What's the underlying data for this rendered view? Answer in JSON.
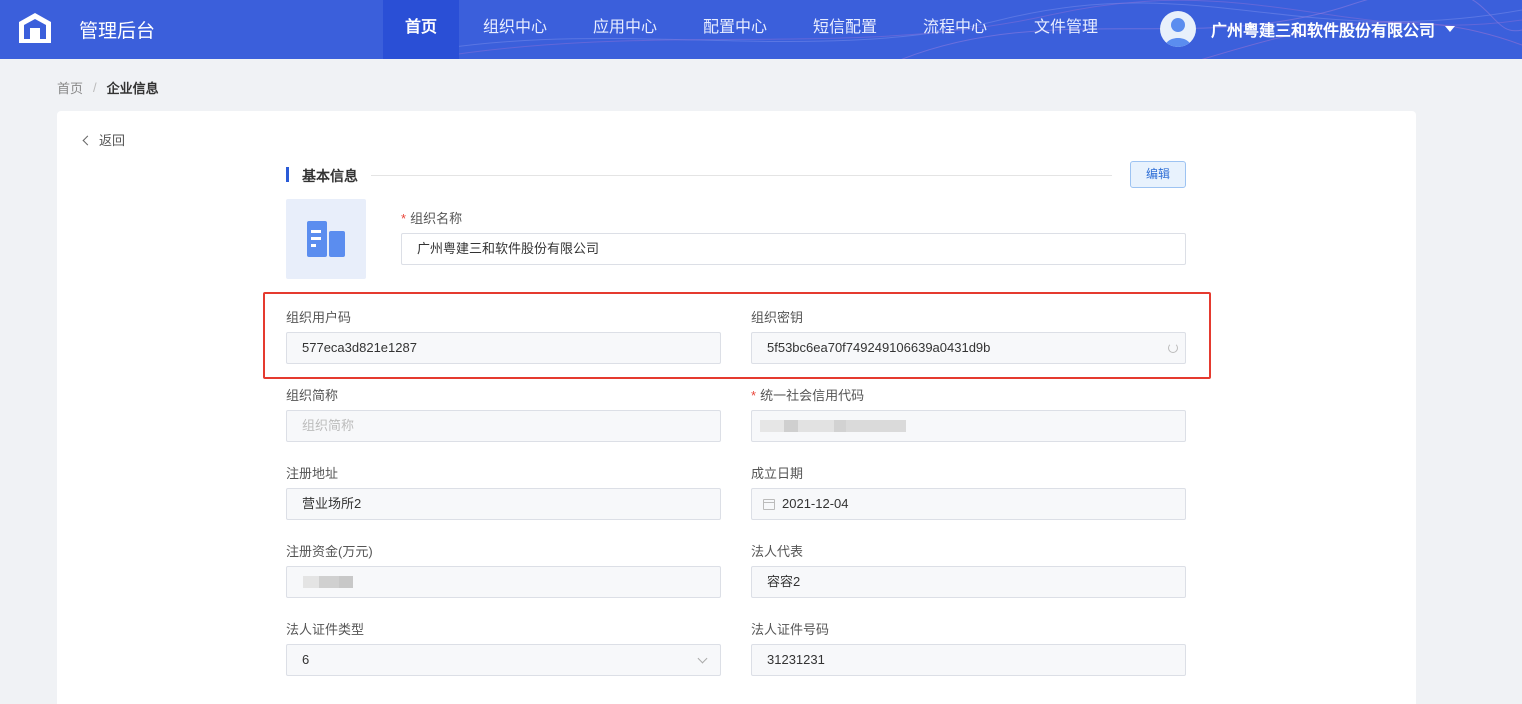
{
  "header": {
    "app_title": "管理后台",
    "nav": [
      "首页",
      "组织中心",
      "应用中心",
      "配置中心",
      "短信配置",
      "流程中心",
      "文件管理"
    ],
    "active_nav": "首页",
    "user_name": "广州粤建三和软件股份有限公司"
  },
  "breadcrumb": {
    "home": "首页",
    "separator": "/",
    "current": "企业信息"
  },
  "back_label": "返回",
  "section": {
    "title": "基本信息",
    "edit_label": "编辑"
  },
  "form": {
    "org_name": {
      "label": "组织名称",
      "required": "*",
      "value": "广州粤建三和软件股份有限公司"
    },
    "org_user_code": {
      "label": "组织用户码",
      "value": "577eca3d821e1287"
    },
    "org_secret": {
      "label": "组织密钥",
      "value": "5f53bc6ea70f749249106639a0431d9b"
    },
    "short_name": {
      "label": "组织简称",
      "placeholder": "组织简称"
    },
    "credit_code": {
      "label": "统一社会信用代码",
      "required": "*"
    },
    "address": {
      "label": "注册地址",
      "value": "营业场所2"
    },
    "found_date": {
      "label": "成立日期",
      "value": "2021-12-04"
    },
    "capital": {
      "label": "注册资金(万元)"
    },
    "legal_rep": {
      "label": "法人代表",
      "value": "容容2"
    },
    "id_type": {
      "label": "法人证件类型",
      "value": "6"
    },
    "id_number": {
      "label": "法人证件号码",
      "value": "31231231"
    }
  },
  "colors": {
    "header_bg": "#3b5fdb",
    "accent": "#2a5bd7",
    "highlight": "#e53a2f"
  }
}
